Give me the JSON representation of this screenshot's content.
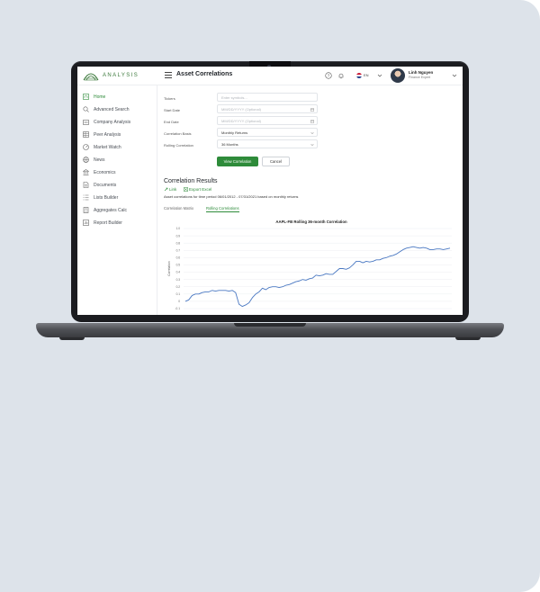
{
  "app": {
    "brand": "ANALYSIS",
    "page_title": "Asset Correlations",
    "language": "EN",
    "user_name": "Linh Nguyen",
    "user_role": "Finance Expert",
    "accent_color": "#2e8b3a"
  },
  "sidebar": {
    "items": [
      {
        "label": "Home",
        "icon": "home-icon",
        "active": true
      },
      {
        "label": "Advanced Search",
        "icon": "search-icon"
      },
      {
        "label": "Company Analysis",
        "icon": "building-icon"
      },
      {
        "label": "Peer Analysis",
        "icon": "table-icon"
      },
      {
        "label": "Market Watch",
        "icon": "gauge-icon"
      },
      {
        "label": "News",
        "icon": "globe-icon"
      },
      {
        "label": "Economics",
        "icon": "bank-icon"
      },
      {
        "label": "Documents",
        "icon": "document-icon"
      },
      {
        "label": "Lists Builder",
        "icon": "list-icon"
      },
      {
        "label": "Aggregates Calc",
        "icon": "calculator-icon"
      },
      {
        "label": "Report Builder",
        "icon": "report-icon"
      }
    ]
  },
  "form": {
    "tickers_label": "Tickers",
    "tickers_placeholder": "Enter symbols...",
    "start_date_label": "Start Date",
    "start_date_placeholder": "MM/DD/YYYY (Optional)",
    "end_date_label": "End Date",
    "end_date_placeholder": "MM/DD/YYYY (Optional)",
    "basis_label": "Correlation Basis",
    "basis_value": "Monthly Returns",
    "rolling_label": "Rolling Correlation",
    "rolling_value": "36 Months",
    "view_button": "View Correlation",
    "cancel_button": "Cancel"
  },
  "results": {
    "title": "Correlation Results",
    "link_label": "Link",
    "export_label": "Export Excel",
    "description": "Asset correlations for time period 06/01/2012 - 07/31/2021 based on monthly returns",
    "tabs": [
      "Correlation Matrix",
      "Rolling Correlations"
    ]
  },
  "chart_data": {
    "type": "line",
    "title": "AAPL-FB Rolling 36-month Correlation",
    "ylabel": "Correlation",
    "ylim": [
      -0.1,
      1.0
    ],
    "yticks": [
      "1.0",
      "0.9",
      "0.8",
      "0.7",
      "0.6",
      "0.5",
      "0.4",
      "0.3",
      "0.2",
      "0.1",
      "0",
      "-0.1"
    ],
    "grid": true,
    "series": [
      {
        "color": "#4a78c2",
        "values": [
          0.0,
          0.02,
          0.08,
          0.1,
          0.1,
          0.12,
          0.13,
          0.13,
          0.15,
          0.14,
          0.15,
          0.15,
          0.15,
          0.14,
          0.15,
          0.12,
          -0.04,
          -0.07,
          -0.05,
          -0.02,
          0.05,
          0.1,
          0.13,
          0.18,
          0.16,
          0.19,
          0.2,
          0.2,
          0.19,
          0.2,
          0.22,
          0.23,
          0.25,
          0.27,
          0.28,
          0.3,
          0.29,
          0.31,
          0.32,
          0.36,
          0.35,
          0.36,
          0.38,
          0.37,
          0.37,
          0.41,
          0.45,
          0.45,
          0.44,
          0.46,
          0.5,
          0.55,
          0.55,
          0.53,
          0.55,
          0.54,
          0.55,
          0.57,
          0.57,
          0.59,
          0.6,
          0.62,
          0.63,
          0.65,
          0.68,
          0.71,
          0.73,
          0.74,
          0.75,
          0.74,
          0.73,
          0.74,
          0.73,
          0.71,
          0.71,
          0.72,
          0.72,
          0.71,
          0.72,
          0.73
        ]
      }
    ]
  }
}
